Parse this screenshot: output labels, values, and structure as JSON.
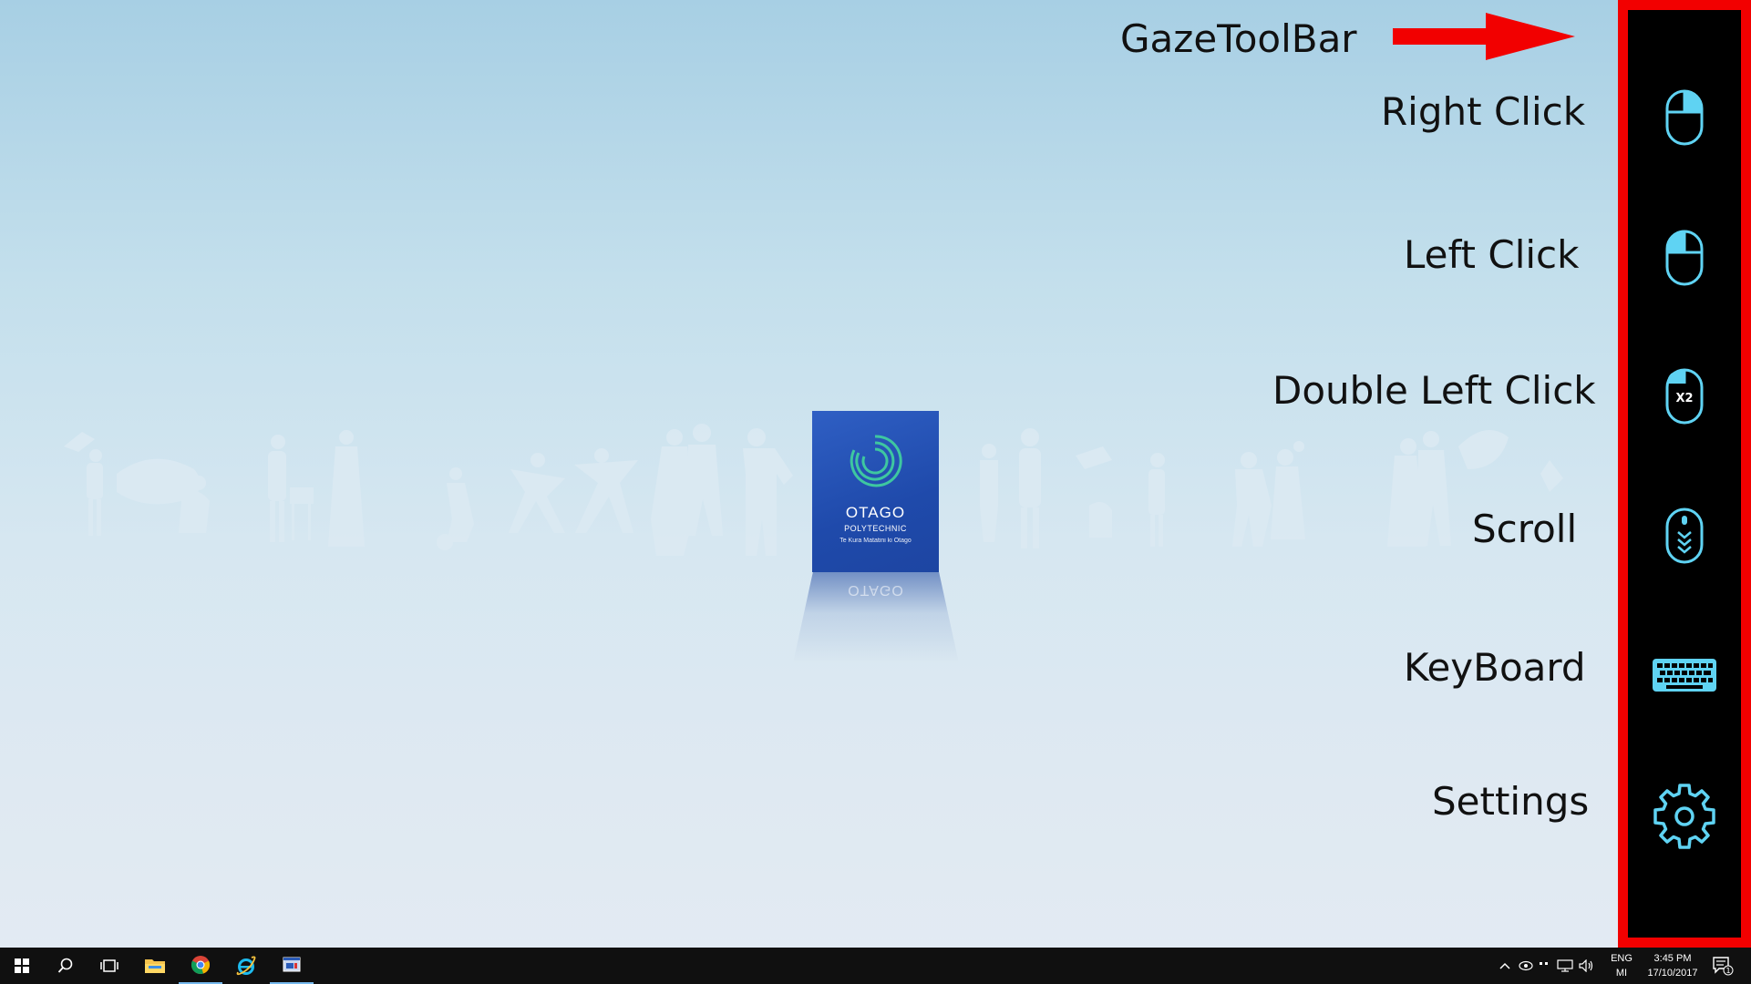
{
  "annotations": {
    "title": "GazeToolBar",
    "right_click": "Right Click",
    "left_click": "Left Click",
    "double_left_click": "Double Left Click",
    "scroll": "Scroll",
    "keyboard": "KeyBoard",
    "settings": "Settings"
  },
  "logo": {
    "name": "OTAGO",
    "sub": "POLYTECHNIC",
    "tagline": "Te Kura Matatini ki Otago"
  },
  "toolbar": {
    "double_click_badge": "X2",
    "buttons": [
      "right-click",
      "left-click",
      "double-left-click",
      "scroll",
      "keyboard",
      "settings"
    ]
  },
  "taskbar": {
    "language_line1": "ENG",
    "language_line2": "MI",
    "time": "3:45 PM",
    "date": "17/10/2017",
    "notification_count": "1"
  },
  "colors": {
    "toolbar_border": "#f20000",
    "toolbar_bg": "#000000",
    "icon_stroke": "#5fd3f3",
    "arrow": "#f20000",
    "logo_bg": "#2152b5",
    "logo_ring": "#3ec7a0"
  }
}
